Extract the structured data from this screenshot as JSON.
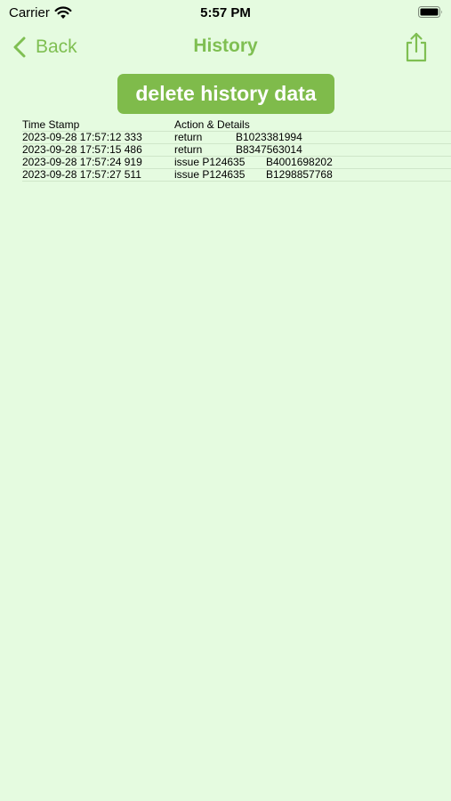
{
  "status_bar": {
    "carrier": "Carrier",
    "time": "5:57 PM",
    "wifi_icon": "wifi-icon",
    "battery_icon": "battery-full-icon"
  },
  "nav": {
    "back_label": "Back",
    "back_icon": "chevron-left-icon",
    "title": "History",
    "share_icon": "share-icon"
  },
  "actions": {
    "delete_label": "delete history data"
  },
  "table": {
    "headers": {
      "timestamp": "Time Stamp",
      "action": "Action & Details"
    },
    "rows": [
      {
        "timestamp": "2023-09-28 17:57:12 333",
        "action": "return",
        "detail": "B1023381994"
      },
      {
        "timestamp": "2023-09-28 17:57:15 486",
        "action": "return",
        "detail": "B8347563014"
      },
      {
        "timestamp": "2023-09-28 17:57:24 919",
        "action": "issue P124635",
        "detail": "B4001698202"
      },
      {
        "timestamp": "2023-09-28 17:57:27 511",
        "action": "issue P124635",
        "detail": "B1298857768"
      }
    ]
  },
  "colors": {
    "background": "#e5fbe0",
    "accent": "#7fbf52",
    "button": "#7fbb4b"
  }
}
